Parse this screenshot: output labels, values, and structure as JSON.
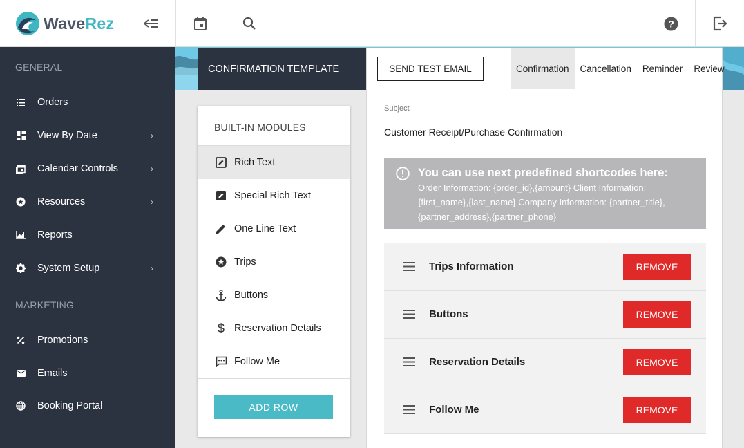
{
  "app": {
    "logo_wave": "Wave",
    "logo_rez": "Rez",
    "accent_color": "#3fb7c3",
    "sidebar_color": "#2b3240",
    "remove_color": "#e02a2a"
  },
  "topbar": {
    "icons": [
      "collapse-menu-icon",
      "calendar-icon",
      "search-icon",
      "help-icon",
      "logout-icon"
    ]
  },
  "sidebar": {
    "section_general": "GENERAL",
    "section_marketing": "MARKETING",
    "items": [
      {
        "label": "Orders",
        "icon": "list-icon"
      },
      {
        "label": "View By Date",
        "icon": "dashboard-icon",
        "chevron": "›"
      },
      {
        "label": "Calendar Controls",
        "icon": "calendar-controls-icon",
        "chevron": "›"
      },
      {
        "label": "Resources",
        "icon": "resources-icon",
        "chevron": "›"
      },
      {
        "label": "Reports",
        "icon": "chart-icon"
      },
      {
        "label": "System Setup",
        "icon": "gear-icon",
        "chevron": "›"
      },
      {
        "label": "Promotions",
        "icon": "percent-icon"
      },
      {
        "label": "Emails",
        "icon": "mail-icon"
      },
      {
        "label": "Booking Portal",
        "icon": "globe-icon"
      }
    ]
  },
  "header": {
    "template_title": "CONFIRMATION TEMPLATE",
    "send_test_email": "SEND TEST EMAIL",
    "tabs": [
      {
        "label": "Confirmation",
        "active": true
      },
      {
        "label": "Cancellation"
      },
      {
        "label": "Reminder"
      },
      {
        "label": "Review"
      }
    ]
  },
  "modules": {
    "title": "BUILT-IN MODULES",
    "items": [
      {
        "label": "Rich Text",
        "icon": "rich-text-icon",
        "active": true
      },
      {
        "label": "Special Rich Text",
        "icon": "special-rich-text-icon"
      },
      {
        "label": "One Line Text",
        "icon": "pencil-icon"
      },
      {
        "label": "Trips",
        "icon": "star-icon"
      },
      {
        "label": "Buttons",
        "icon": "anchor-icon"
      },
      {
        "label": "Reservation Details",
        "icon": "dollar-icon"
      },
      {
        "label": "Follow Me",
        "icon": "comment-icon"
      }
    ],
    "add_row": "ADD ROW"
  },
  "editor": {
    "subject_label": "Subject",
    "subject_value": "Customer Receipt/Purchase Confirmation",
    "notice_title": "You can use next predefined shortcodes here:",
    "notice_body": "Order Information: {order_id},{amount} Client Information: {first_name},{last_name} Company Information: {partner_title},{partner_address},{partner_phone}",
    "rows": [
      {
        "label": "Trips Information",
        "remove": "REMOVE"
      },
      {
        "label": "Buttons",
        "remove": "REMOVE"
      },
      {
        "label": "Reservation Details",
        "remove": "REMOVE"
      },
      {
        "label": "Follow Me",
        "remove": "REMOVE"
      }
    ]
  }
}
